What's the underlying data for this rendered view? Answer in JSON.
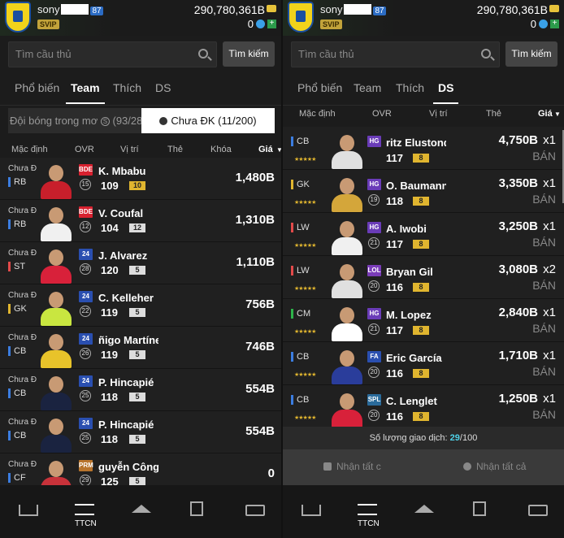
{
  "screen_a": {
    "header": {
      "username": "sony",
      "username_suffix": "87",
      "vip": "SVIP",
      "money": "290,780,361B",
      "cash": "0"
    },
    "search": {
      "placeholder": "Tìm cầu thủ",
      "button": "Tìm kiếm"
    },
    "tabs": [
      "Phổ biến",
      "Team",
      "Thích",
      "DS"
    ],
    "active_tab": "Team",
    "toggle": {
      "left": "Đội bóng trong mơ",
      "left_count": "(93/28",
      "right": "Chưa ĐK (11/200)"
    },
    "sort_headers": [
      "Mặc định",
      "OVR",
      "Vị trí",
      "Thẻ",
      "Khóa",
      "Giá"
    ],
    "rows": [
      {
        "status": "Chưa Đ",
        "pos": "RB",
        "season": "BDE",
        "num": "15",
        "name": "K. Mbabu",
        "ovr": "109",
        "upg": "10",
        "price": "1,480B"
      },
      {
        "status": "Chưa Đ",
        "pos": "RB",
        "season": "BDE",
        "num": "12",
        "name": "V. Coufal",
        "ovr": "104",
        "upg": "12",
        "price": "1,310B"
      },
      {
        "status": "Chưa Đ",
        "pos": "ST",
        "season": "24",
        "num": "28",
        "name": "J. Alvarez",
        "ovr": "120",
        "upg": "5",
        "price": "1,110B"
      },
      {
        "status": "Chưa Đ",
        "pos": "GK",
        "season": "24",
        "num": "22",
        "name": "C. Kelleher",
        "ovr": "119",
        "upg": "5",
        "price": "756B"
      },
      {
        "status": "Chưa Đ",
        "pos": "CB",
        "season": "24",
        "num": "26",
        "name": "ñigo Martíne",
        "ovr": "119",
        "upg": "5",
        "price": "746B"
      },
      {
        "status": "Chưa Đ",
        "pos": "CB",
        "season": "24",
        "num": "25",
        "name": "P. Hincapié",
        "ovr": "118",
        "upg": "5",
        "price": "554B"
      },
      {
        "status": "Chưa Đ",
        "pos": "CB",
        "season": "24",
        "num": "25",
        "name": "P. Hincapié",
        "ovr": "118",
        "upg": "5",
        "price": "554B"
      },
      {
        "status": "Chưa Đ",
        "pos": "CF",
        "season": "PRM",
        "num": "29",
        "name": "guyễn Công P",
        "ovr": "125",
        "upg": "5",
        "price": "0"
      }
    ],
    "nav": {
      "active_label": "TTCN"
    }
  },
  "screen_b": {
    "header": {
      "username": "sony",
      "username_suffix": "87",
      "vip": "SVIP",
      "money": "290,780,361B",
      "cash": "0"
    },
    "search": {
      "placeholder": "Tìm cầu thủ",
      "button": "Tìm kiếm"
    },
    "tabs": [
      "Phổ biến",
      "Team",
      "Thích",
      "DS"
    ],
    "active_tab": "DS",
    "sort_headers": [
      "Mặc định",
      "OVR",
      "Vị trí",
      "Thẻ",
      "Giá"
    ],
    "rows": [
      {
        "pos": "CB",
        "season": "HG",
        "num": "",
        "name": "ritz Elustondo",
        "ovr": "117",
        "upg": "8",
        "price": "4,750B",
        "qty": "x1",
        "action": "BÁN"
      },
      {
        "pos": "GK",
        "season": "HG",
        "num": "19",
        "name": "O. Baumann",
        "ovr": "118",
        "upg": "8",
        "price": "3,350B",
        "qty": "x1",
        "action": "BÁN"
      },
      {
        "pos": "LW",
        "season": "HG",
        "num": "21",
        "name": "A. Iwobi",
        "ovr": "117",
        "upg": "8",
        "price": "3,250B",
        "qty": "x1",
        "action": "BÁN"
      },
      {
        "pos": "LW",
        "season": "LOL",
        "num": "20",
        "name": "Bryan Gil",
        "ovr": "116",
        "upg": "8",
        "price": "3,080B",
        "qty": "x2",
        "action": "BÁN"
      },
      {
        "pos": "CM",
        "season": "HG",
        "num": "21",
        "name": "M. Lopez",
        "ovr": "117",
        "upg": "8",
        "price": "2,840B",
        "qty": "x1",
        "action": "BÁN"
      },
      {
        "pos": "CB",
        "season": "FA",
        "num": "20",
        "name": "Eric García",
        "ovr": "116",
        "upg": "8",
        "price": "1,710B",
        "qty": "x1",
        "action": "BÁN"
      },
      {
        "pos": "CB",
        "season": "SPL",
        "num": "20",
        "name": "C. Lenglet",
        "ovr": "116",
        "upg": "8",
        "price": "1,250B",
        "qty": "x1",
        "action": "BÁN"
      }
    ],
    "transactions": {
      "label": "Số lượng giao dịch:",
      "used": "29",
      "total": "/100"
    },
    "actions": {
      "left": "Nhận tất c",
      "right": "Nhận tất cả"
    },
    "nav": {
      "active_label": "TTCN"
    }
  },
  "colors": {
    "season_bde": "#d8212f",
    "season_24": "#2a4fb0",
    "season_hg": "#6a3cb8",
    "season_lol": "#7a3cb8",
    "season_fa": "#2a4fb0",
    "season_spl": "#2a6b9b",
    "season_prm": "#b8742c",
    "accent_cyan": "#4fd1e8"
  }
}
